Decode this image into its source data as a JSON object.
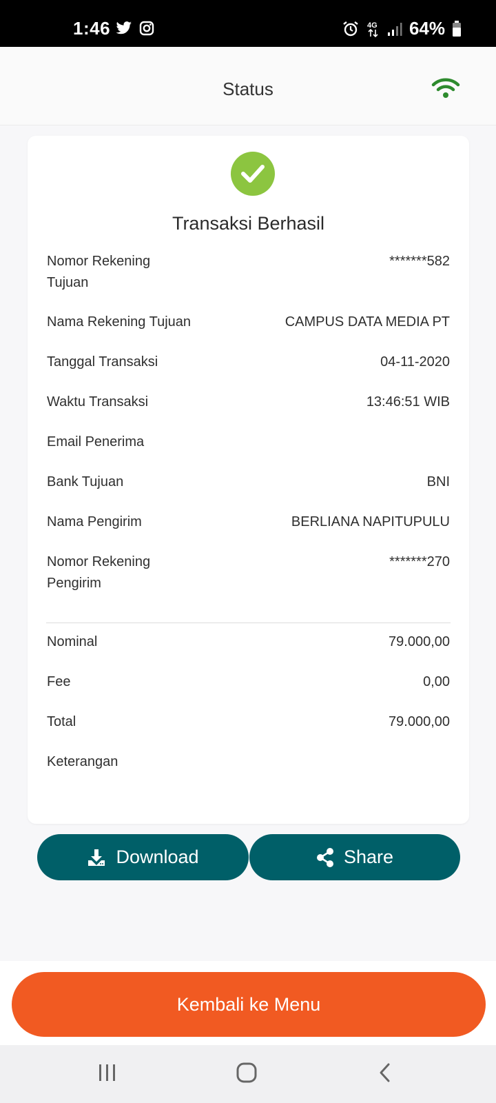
{
  "status_bar": {
    "time": "1:46",
    "left_icons": [
      "twitter-icon",
      "instagram-icon"
    ],
    "right_icons": [
      "alarm-icon",
      "4g-icon",
      "signal-icon"
    ],
    "battery": "64%"
  },
  "header": {
    "title": "Status",
    "connection_icon": "wifi-icon",
    "connection_color": "#2e8b2e"
  },
  "result": {
    "icon": "check-circle-icon",
    "icon_color": "#8cc540",
    "title": "Transaksi Berhasil"
  },
  "details": [
    {
      "label": "Nomor Rekening Tujuan",
      "value": "*******582"
    },
    {
      "label": "Nama Rekening Tujuan",
      "value": "CAMPUS DATA MEDIA PT"
    },
    {
      "label": "Tanggal Transaksi",
      "value": "04-11-2020"
    },
    {
      "label": "Waktu Transaksi",
      "value": "13:46:51 WIB"
    },
    {
      "label": "Email Penerima",
      "value": ""
    },
    {
      "label": "Bank Tujuan",
      "value": "BNI"
    },
    {
      "label": "Nama Pengirim",
      "value": "BERLIANA NAPITUPULU"
    },
    {
      "label": "Nomor Rekening Pengirim",
      "value": "*******270"
    }
  ],
  "amounts": [
    {
      "label": "Nominal",
      "value": "79.000,00"
    },
    {
      "label": "Fee",
      "value": "0,00"
    },
    {
      "label": "Total",
      "value": "79.000,00"
    },
    {
      "label": "Keterangan",
      "value": ""
    }
  ],
  "actions": {
    "download_label": "Download",
    "share_label": "Share",
    "color": "#005f68"
  },
  "footer": {
    "menu_label": "Kembali ke Menu",
    "color": "#f15a22"
  },
  "navbar": {
    "items": [
      "recent-apps-icon",
      "home-icon",
      "back-icon"
    ]
  }
}
